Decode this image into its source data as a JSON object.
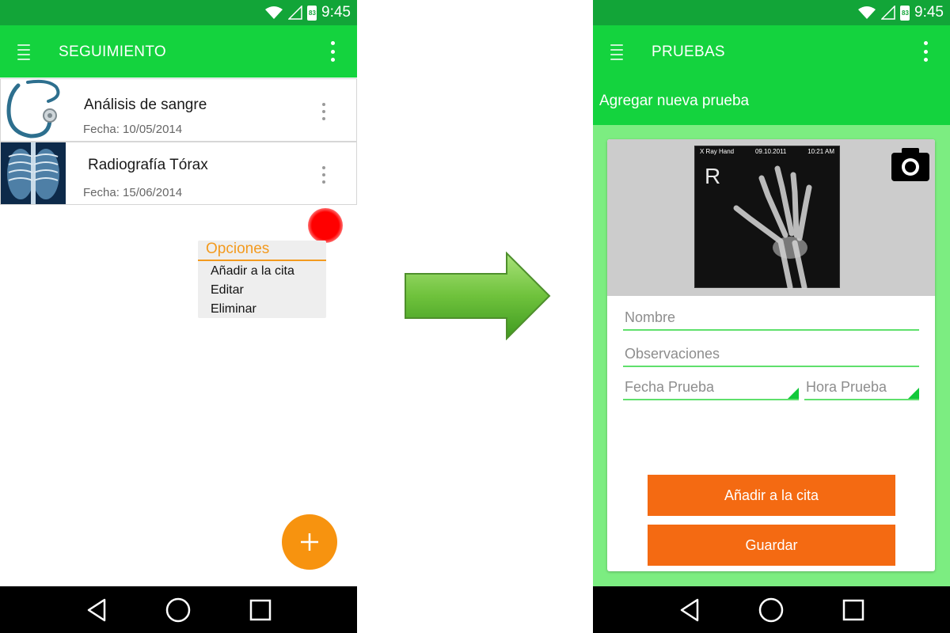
{
  "status_bar": {
    "time": "9:45",
    "battery_level": "83"
  },
  "left_screen": {
    "app_title": "SEGUIMIENTO",
    "items": [
      {
        "title": "Análisis de sangre",
        "date": "Fecha: 10/05/2014",
        "thumb_icon": "stethoscope-icon"
      },
      {
        "title": "Radiografía Tórax",
        "date": "Fecha: 15/06/2014",
        "thumb_icon": "chest-xray-image"
      }
    ],
    "context_menu": {
      "title": "Opciones",
      "items": [
        "Añadir a la cita",
        "Editar",
        "Eliminar"
      ]
    },
    "fab_icon": "plus-icon"
  },
  "right_screen": {
    "app_title": "PRUEBAS",
    "sub_header": "Agregar nueva prueba",
    "xray": {
      "label_left": "X Ray   Hand",
      "date": "09.10.2011",
      "time": "10:21 AM",
      "marker": "R"
    },
    "fields": {
      "nombre": "Nombre",
      "observaciones": "Observaciones",
      "fecha": "Fecha Prueba",
      "hora": "Hora Prueba"
    },
    "buttons": {
      "add": "Añadir a la cita",
      "save": "Guardar"
    }
  },
  "colors": {
    "status_bar": "#12a538",
    "app_bar": "#14d33e",
    "form_background": "#7ced81",
    "accent_orange": "#f46a12",
    "fab": "#f7930f",
    "menu_accent": "#f39a1e"
  }
}
